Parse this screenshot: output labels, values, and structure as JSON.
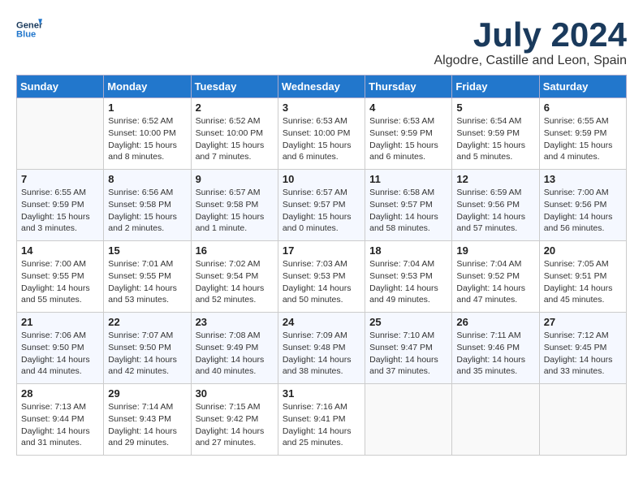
{
  "header": {
    "logo_line1": "General",
    "logo_line2": "Blue",
    "month": "July 2024",
    "location": "Algodre, Castille and Leon, Spain"
  },
  "weekdays": [
    "Sunday",
    "Monday",
    "Tuesday",
    "Wednesday",
    "Thursday",
    "Friday",
    "Saturday"
  ],
  "weeks": [
    [
      {
        "day": "",
        "content": ""
      },
      {
        "day": "1",
        "content": "Sunrise: 6:52 AM\nSunset: 10:00 PM\nDaylight: 15 hours\nand 8 minutes."
      },
      {
        "day": "2",
        "content": "Sunrise: 6:52 AM\nSunset: 10:00 PM\nDaylight: 15 hours\nand 7 minutes."
      },
      {
        "day": "3",
        "content": "Sunrise: 6:53 AM\nSunset: 10:00 PM\nDaylight: 15 hours\nand 6 minutes."
      },
      {
        "day": "4",
        "content": "Sunrise: 6:53 AM\nSunset: 9:59 PM\nDaylight: 15 hours\nand 6 minutes."
      },
      {
        "day": "5",
        "content": "Sunrise: 6:54 AM\nSunset: 9:59 PM\nDaylight: 15 hours\nand 5 minutes."
      },
      {
        "day": "6",
        "content": "Sunrise: 6:55 AM\nSunset: 9:59 PM\nDaylight: 15 hours\nand 4 minutes."
      }
    ],
    [
      {
        "day": "7",
        "content": "Sunrise: 6:55 AM\nSunset: 9:59 PM\nDaylight: 15 hours\nand 3 minutes."
      },
      {
        "day": "8",
        "content": "Sunrise: 6:56 AM\nSunset: 9:58 PM\nDaylight: 15 hours\nand 2 minutes."
      },
      {
        "day": "9",
        "content": "Sunrise: 6:57 AM\nSunset: 9:58 PM\nDaylight: 15 hours\nand 1 minute."
      },
      {
        "day": "10",
        "content": "Sunrise: 6:57 AM\nSunset: 9:57 PM\nDaylight: 15 hours\nand 0 minutes."
      },
      {
        "day": "11",
        "content": "Sunrise: 6:58 AM\nSunset: 9:57 PM\nDaylight: 14 hours\nand 58 minutes."
      },
      {
        "day": "12",
        "content": "Sunrise: 6:59 AM\nSunset: 9:56 PM\nDaylight: 14 hours\nand 57 minutes."
      },
      {
        "day": "13",
        "content": "Sunrise: 7:00 AM\nSunset: 9:56 PM\nDaylight: 14 hours\nand 56 minutes."
      }
    ],
    [
      {
        "day": "14",
        "content": "Sunrise: 7:00 AM\nSunset: 9:55 PM\nDaylight: 14 hours\nand 55 minutes."
      },
      {
        "day": "15",
        "content": "Sunrise: 7:01 AM\nSunset: 9:55 PM\nDaylight: 14 hours\nand 53 minutes."
      },
      {
        "day": "16",
        "content": "Sunrise: 7:02 AM\nSunset: 9:54 PM\nDaylight: 14 hours\nand 52 minutes."
      },
      {
        "day": "17",
        "content": "Sunrise: 7:03 AM\nSunset: 9:53 PM\nDaylight: 14 hours\nand 50 minutes."
      },
      {
        "day": "18",
        "content": "Sunrise: 7:04 AM\nSunset: 9:53 PM\nDaylight: 14 hours\nand 49 minutes."
      },
      {
        "day": "19",
        "content": "Sunrise: 7:04 AM\nSunset: 9:52 PM\nDaylight: 14 hours\nand 47 minutes."
      },
      {
        "day": "20",
        "content": "Sunrise: 7:05 AM\nSunset: 9:51 PM\nDaylight: 14 hours\nand 45 minutes."
      }
    ],
    [
      {
        "day": "21",
        "content": "Sunrise: 7:06 AM\nSunset: 9:50 PM\nDaylight: 14 hours\nand 44 minutes."
      },
      {
        "day": "22",
        "content": "Sunrise: 7:07 AM\nSunset: 9:50 PM\nDaylight: 14 hours\nand 42 minutes."
      },
      {
        "day": "23",
        "content": "Sunrise: 7:08 AM\nSunset: 9:49 PM\nDaylight: 14 hours\nand 40 minutes."
      },
      {
        "day": "24",
        "content": "Sunrise: 7:09 AM\nSunset: 9:48 PM\nDaylight: 14 hours\nand 38 minutes."
      },
      {
        "day": "25",
        "content": "Sunrise: 7:10 AM\nSunset: 9:47 PM\nDaylight: 14 hours\nand 37 minutes."
      },
      {
        "day": "26",
        "content": "Sunrise: 7:11 AM\nSunset: 9:46 PM\nDaylight: 14 hours\nand 35 minutes."
      },
      {
        "day": "27",
        "content": "Sunrise: 7:12 AM\nSunset: 9:45 PM\nDaylight: 14 hours\nand 33 minutes."
      }
    ],
    [
      {
        "day": "28",
        "content": "Sunrise: 7:13 AM\nSunset: 9:44 PM\nDaylight: 14 hours\nand 31 minutes."
      },
      {
        "day": "29",
        "content": "Sunrise: 7:14 AM\nSunset: 9:43 PM\nDaylight: 14 hours\nand 29 minutes."
      },
      {
        "day": "30",
        "content": "Sunrise: 7:15 AM\nSunset: 9:42 PM\nDaylight: 14 hours\nand 27 minutes."
      },
      {
        "day": "31",
        "content": "Sunrise: 7:16 AM\nSunset: 9:41 PM\nDaylight: 14 hours\nand 25 minutes."
      },
      {
        "day": "",
        "content": ""
      },
      {
        "day": "",
        "content": ""
      },
      {
        "day": "",
        "content": ""
      }
    ]
  ]
}
